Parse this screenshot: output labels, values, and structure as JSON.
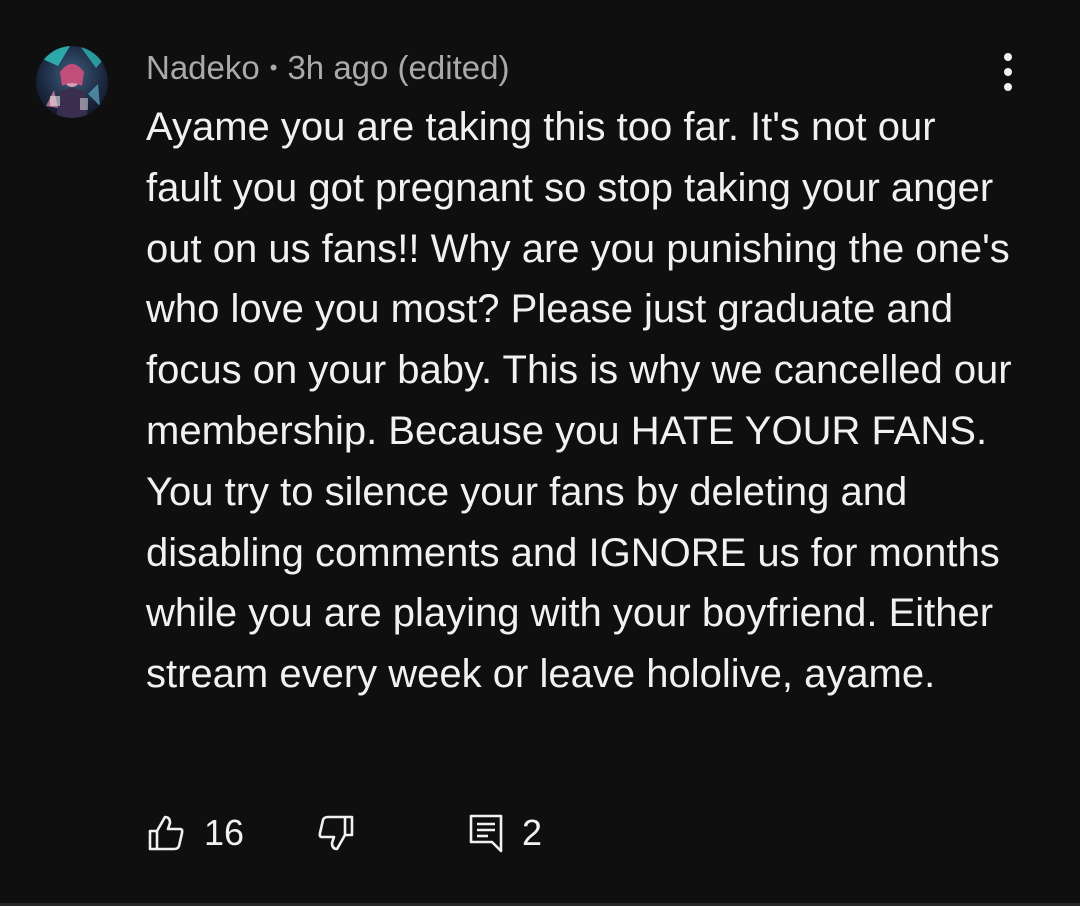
{
  "comment": {
    "author": "Nadeko",
    "separator": "•",
    "timestamp": "3h ago (edited)",
    "avatar_icon": "user-avatar-anime-art",
    "text": "Ayame you are taking this too far. It's not our fault you got pregnant so stop taking your anger out on us fans!! Why are you punishing the one's who love you most? Please just graduate and focus on your baby. This is why we cancelled our membership. Because you HATE YOUR FANS. You try to silence your fans by deleting and disabling comments and IGNORE us for months while you are playing with your boyfriend. Either stream every week or leave hololive, ayame.",
    "more_icon": "more-vert-icon",
    "actions": {
      "like_icon": "thumbs-up-icon",
      "like_count": "16",
      "dislike_icon": "thumbs-down-icon",
      "reply_icon": "reply-comment-icon",
      "reply_count": "2"
    }
  },
  "colors": {
    "background": "#0f0f0f",
    "meta_text": "#aaaaaa",
    "body_text": "#f1f1f1"
  }
}
